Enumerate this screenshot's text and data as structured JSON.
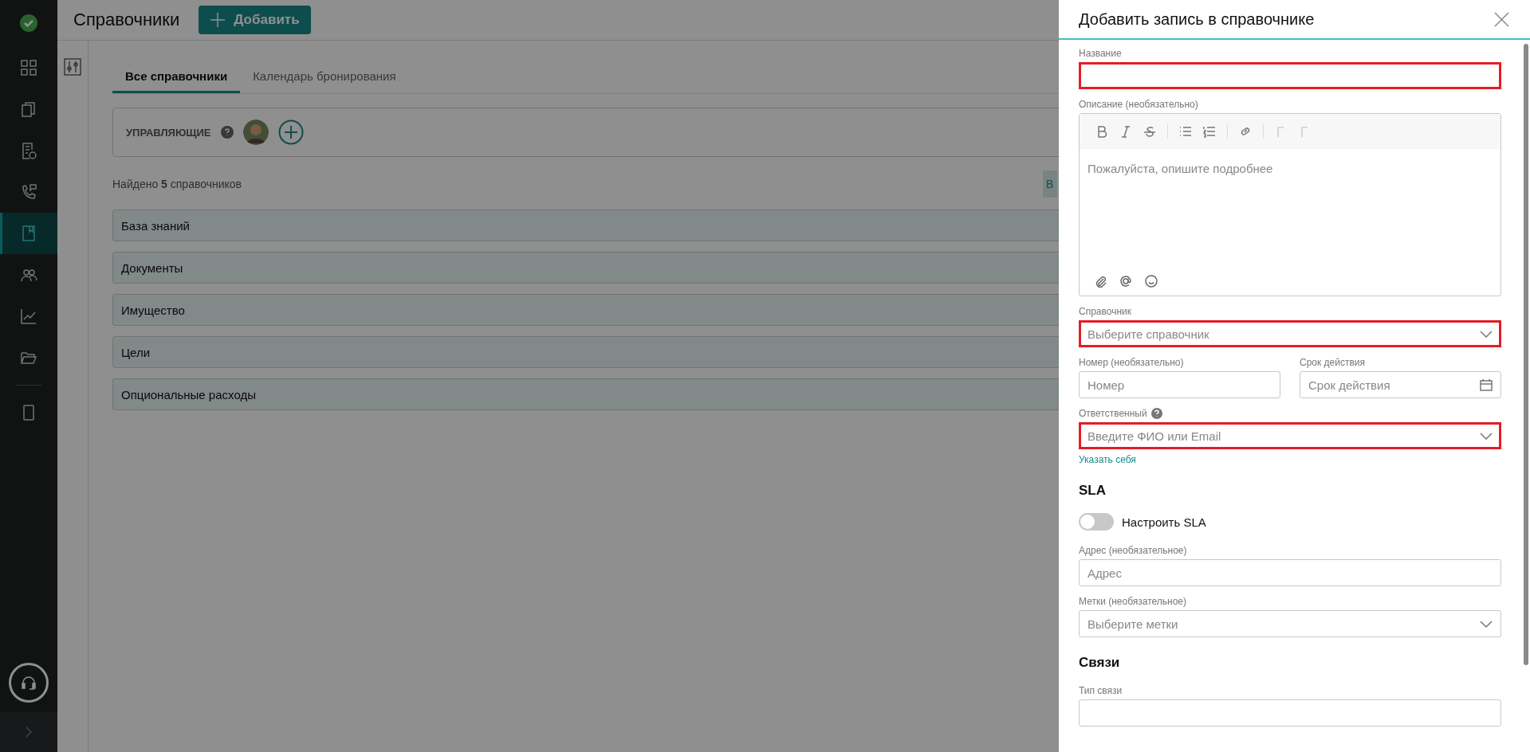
{
  "sidebar": {
    "items": [
      {
        "kind": "grid",
        "selected": false
      },
      {
        "kind": "docs",
        "selected": false
      },
      {
        "kind": "request",
        "selected": false
      },
      {
        "kind": "phone",
        "selected": false
      },
      {
        "kind": "book",
        "selected": true
      },
      {
        "kind": "people",
        "selected": false
      },
      {
        "kind": "chart",
        "selected": false
      },
      {
        "kind": "folder",
        "selected": false
      },
      {
        "kind": "divider"
      },
      {
        "kind": "tablet",
        "selected": false
      }
    ]
  },
  "header": {
    "title": "Справочники",
    "add_button": "Добавить"
  },
  "tabs": [
    {
      "label": "Все справочники",
      "selected": true
    },
    {
      "label": "Календарь бронирования",
      "selected": false
    }
  ],
  "managers": {
    "label": "УПРАВЛЯЮЩИЕ"
  },
  "found": "Найдено **5** справочников",
  "side_button": "В",
  "directories": [
    {
      "name": "База знаний"
    },
    {
      "name": "Документы"
    },
    {
      "name": "Имущество"
    },
    {
      "name": "Цели"
    },
    {
      "name": "Опциональные расходы"
    }
  ],
  "panel": {
    "title": "Добавить запись в справочнике",
    "fields": [
      {
        "kind": "text",
        "label": "Название",
        "invalid": true
      },
      {
        "kind": "editor",
        "label": "Описание (необязательно)",
        "placeholder": "Пожалуйста, опишите подробнее",
        "invalid": false
      },
      {
        "kind": "select",
        "label": "Справочник",
        "placeholder": "Выберите справочник",
        "invalid": true
      },
      {
        "kind": "pair",
        "items": [
          {
            "kind": "text",
            "label": "Номер (необязательно)",
            "placeholder": "Номер",
            "invalid": false
          },
          {
            "kind": "date",
            "label": "Срок действия",
            "placeholder": "Срок действия",
            "invalid": false
          }
        ]
      },
      {
        "kind": "select",
        "label": "Ответственный",
        "help": true,
        "placeholder": "Введите ФИО или Email",
        "invalid": true,
        "link": "Указать себя"
      },
      {
        "kind": "heading",
        "label": "SLA"
      },
      {
        "kind": "toggle",
        "label": "Настроить SLA",
        "on": false
      },
      {
        "kind": "text",
        "label": "Адрес (необязательное)",
        "placeholder": "Адрес",
        "invalid": false
      },
      {
        "kind": "select",
        "label": "Метки (необязательное)",
        "placeholder": "Выберите метки",
        "invalid": false
      },
      {
        "kind": "heading",
        "label": "Связи"
      },
      {
        "kind": "text",
        "label": "Тип связи",
        "invalid": false
      }
    ]
  }
}
